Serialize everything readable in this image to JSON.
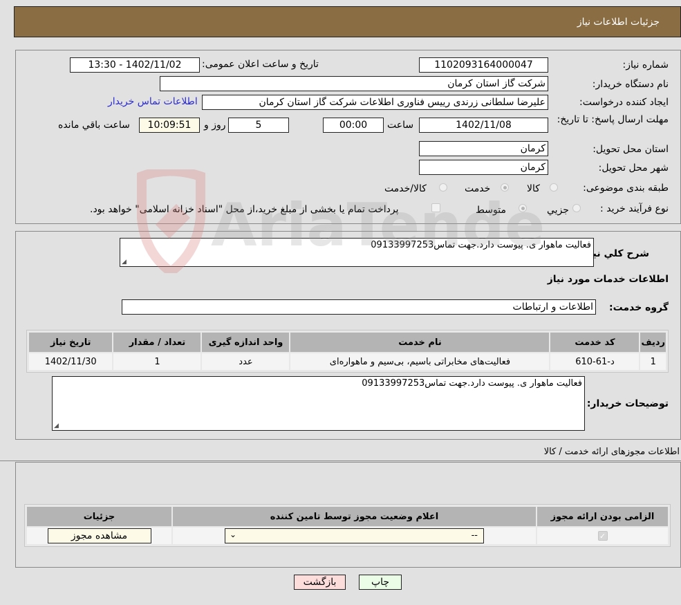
{
  "header": {
    "title": "جزئیات اطلاعات نیاز"
  },
  "details": {
    "need_number_label": "شماره نیاز:",
    "need_number": "1102093164000047",
    "announce_label": "تاریخ و ساعت اعلان عمومی:",
    "announce_value": "1402/11/02 - 13:30",
    "buyer_org_label": "نام دستگاه خریدار:",
    "buyer_org": "شرکت گاز استان کرمان",
    "creator_label": "ایجاد کننده درخواست:",
    "creator": "علیرضا سلطانی زرندی رییس فناوری اطلاعات شرکت گاز استان کرمان",
    "contact_link": "اطلاعات تماس خریدار",
    "deadline_label": "مهلت ارسال پاسخ: تا تاریخ:",
    "deadline_date": "1402/11/08",
    "time_label": "ساعت",
    "deadline_time": "00:00",
    "days_value": "5",
    "days_label": "روز و",
    "remaining_time": "10:09:51",
    "remaining_label": "ساعت باقي مانده",
    "province_label": "استان محل تحویل:",
    "province": "کرمان",
    "city_label": "شهر محل تحویل:",
    "city": "کرمان",
    "category_label": "طبقه بندی موضوعی:",
    "category_options": [
      {
        "label": "کالا",
        "checked": false
      },
      {
        "label": "خدمت",
        "checked": true
      },
      {
        "label": "کالا/خدمت",
        "checked": false
      }
    ],
    "process_label": "نوع فرآیند خرید :",
    "process_options": [
      {
        "label": "جزيي",
        "checked": false
      },
      {
        "label": "متوسط",
        "checked": true
      }
    ],
    "treasury_checkbox_label": "پرداخت تمام یا بخشی از مبلغ خرید،از محل \"اسناد خزانه اسلامی\" خواهد بود.",
    "treasury_checked": false
  },
  "description": {
    "label": "شرح کلي نياز:",
    "value": "فعالیت ماهوار ی. پیوست دارد.جهت تماس09133997253"
  },
  "services": {
    "section_title": "اطلاعات خدمات مورد نياز",
    "group_label": "گروه خدمت:",
    "group_value": "اطلاعات و ارتباطات",
    "table": {
      "headers": [
        "رديف",
        "کد خدمت",
        "نام خدمت",
        "واحد اندازه گیری",
        "تعداد / مقدار",
        "تاریخ نیاز"
      ],
      "rows": [
        [
          "1",
          "د-61-610",
          "فعالیت‌های مخابراتی باسیم، بی‌سیم و ماهواره‌ای",
          "عدد",
          "1",
          "1402/11/30"
        ]
      ]
    },
    "buyer_notes_label": "توضیحات خریدار:",
    "buyer_notes": "فعالیت ماهوار ی. پیوست دارد.جهت تماس09133997253"
  },
  "permits": {
    "section_title": "اطلاعات مجوزهای ارائه خدمت / کالا",
    "table": {
      "headers": [
        "الزامی بودن ارائه مجوز",
        "اعلام وضعیت مجوز توسط تامین کننده",
        "جزئیات"
      ],
      "rows": [
        {
          "required_checked": true,
          "status_selected": "--",
          "details_button": "مشاهده مجوز"
        }
      ]
    }
  },
  "footer": {
    "print_button": "چاپ",
    "back_button": "بازگشت"
  },
  "watermark": {
    "text": "AriaTender.neT"
  }
}
